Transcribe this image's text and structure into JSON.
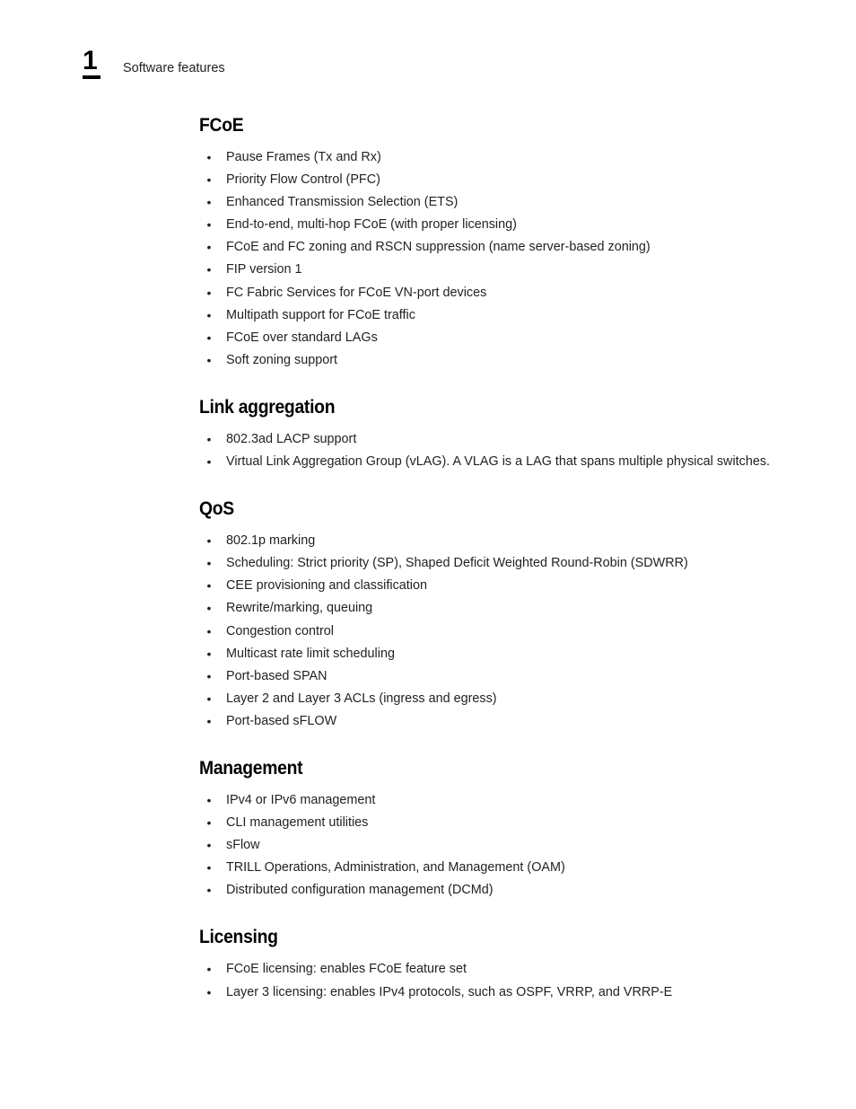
{
  "header": {
    "chapter_number": "1",
    "title": "Software features"
  },
  "bullet_glyph": "•",
  "sections": [
    {
      "heading": "FCoE",
      "items": [
        "Pause Frames (Tx and Rx)",
        "Priority Flow Control (PFC)",
        "Enhanced Transmission Selection (ETS)",
        "End-to-end, multi-hop FCoE (with proper licensing)",
        "FCoE and FC zoning and RSCN suppression (name server-based zoning)",
        "FIP version 1",
        "FC Fabric Services for FCoE VN-port devices",
        "Multipath support for FCoE traffic",
        "FCoE over standard LAGs",
        "Soft zoning support"
      ]
    },
    {
      "heading": "Link aggregation",
      "items": [
        "802.3ad LACP support",
        "Virtual Link Aggregation Group (vLAG). A VLAG is a LAG that spans multiple physical switches."
      ]
    },
    {
      "heading": "QoS",
      "items": [
        "802.1p marking",
        "Scheduling: Strict priority (SP), Shaped Deficit Weighted Round-Robin (SDWRR)",
        "CEE provisioning and classification",
        "Rewrite/marking, queuing",
        "Congestion control",
        "Multicast rate limit scheduling",
        "Port-based SPAN",
        "Layer 2 and Layer 3 ACLs (ingress and egress)",
        "Port-based sFLOW"
      ]
    },
    {
      "heading": "Management",
      "items": [
        "IPv4 or IPv6 management",
        "CLI management utilities",
        "sFlow",
        "TRILL Operations, Administration, and Management (OAM)",
        "Distributed configuration management (DCMd)"
      ]
    },
    {
      "heading": "Licensing",
      "items": [
        "FCoE licensing: enables FCoE feature set",
        "Layer 3 licensing: enables IPv4 protocols, such as OSPF, VRRP, and VRRP-E"
      ]
    }
  ]
}
